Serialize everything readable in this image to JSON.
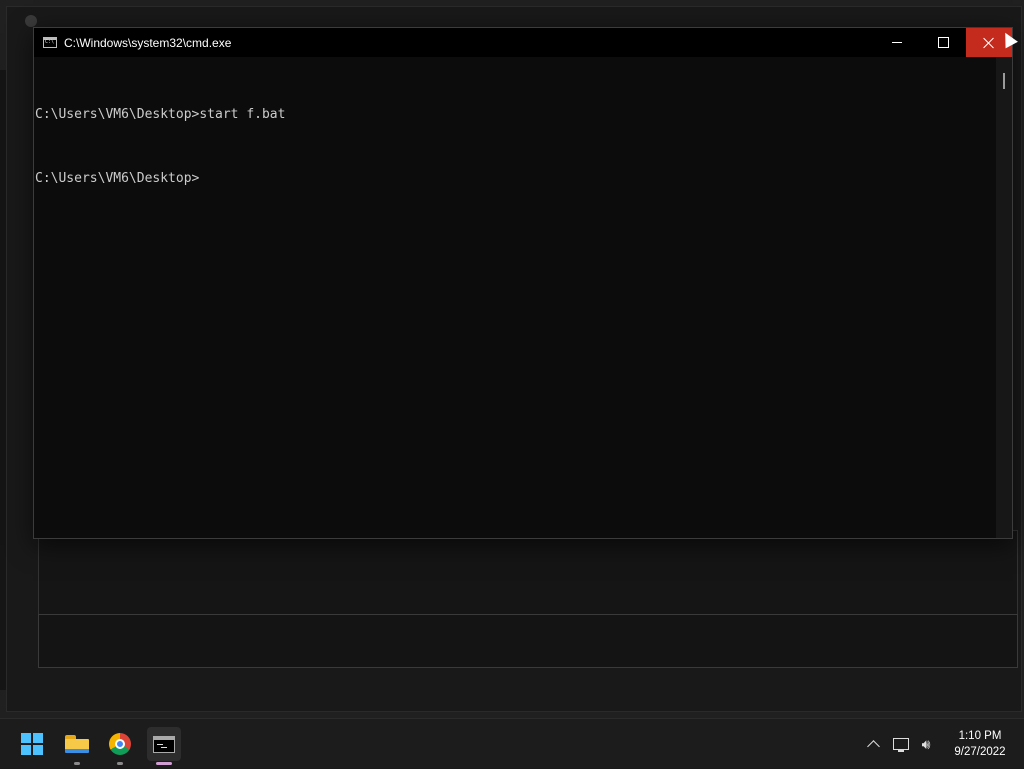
{
  "window": {
    "title": "C:\\Windows\\system32\\cmd.exe",
    "controls": {
      "close_color": "#c42b1c"
    }
  },
  "console": {
    "lines": [
      "C:\\Users\\VM6\\Desktop>start f.bat",
      "C:\\Users\\VM6\\Desktop>"
    ],
    "text_color": "#cccccc",
    "background": "#0c0c0c"
  },
  "taskbar": {
    "items": [
      {
        "name": "Start",
        "icon": "windows-logo-icon"
      },
      {
        "name": "File Explorer",
        "icon": "folder-icon"
      },
      {
        "name": "Google Chrome",
        "icon": "chrome-icon"
      },
      {
        "name": "Command Prompt",
        "icon": "cmd-icon",
        "active": true
      }
    ],
    "tray": {
      "icons": [
        "chevron-up-icon",
        "network-icon",
        "volume-icon"
      ],
      "time": "1:10 PM",
      "date": "9/27/2022"
    }
  },
  "colors": {
    "accent": "#4cc2ff",
    "close_hover": "#c42b1c"
  }
}
